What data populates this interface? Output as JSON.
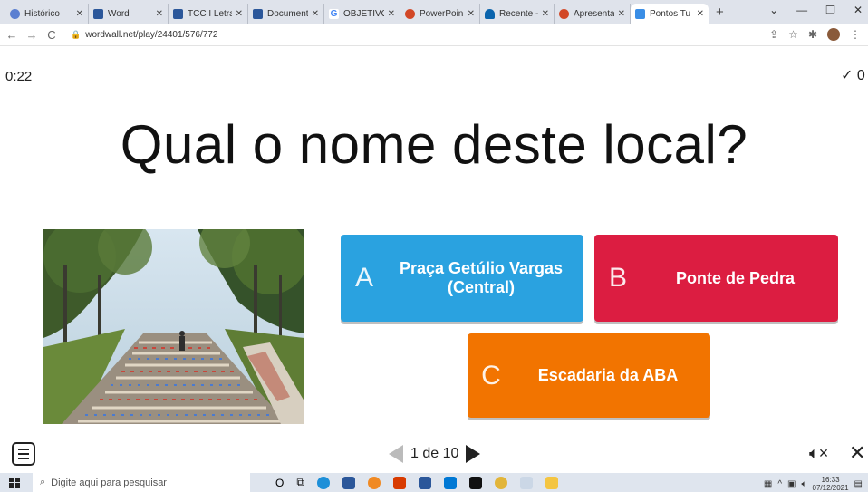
{
  "browser": {
    "tabs": [
      {
        "label": "Histórico",
        "color": "#5b7fd1"
      },
      {
        "label": "Word",
        "color": "#2b579a"
      },
      {
        "label": "TCC I Letra",
        "color": "#2b579a"
      },
      {
        "label": "Document",
        "color": "#2b579a"
      },
      {
        "label": "OBJETIVO",
        "color": "#4285f4"
      },
      {
        "label": "PowerPoin",
        "color": "#d24726"
      },
      {
        "label": "Recente -",
        "color": "#0a64ad"
      },
      {
        "label": "Apresenta",
        "color": "#d24726"
      },
      {
        "label": "Pontos Tu",
        "color": "#3a8ee6",
        "active": true
      }
    ],
    "url": "wordwall.net/play/24401/576/772"
  },
  "game": {
    "timer": "0:22",
    "score": "✓ 0",
    "question": "Qual o nome deste local?",
    "answers": [
      {
        "letter": "A",
        "text": "Praça Getúlio Vargas (Central)",
        "color": "#2aa2e0"
      },
      {
        "letter": "B",
        "text": "Ponte de Pedra",
        "color": "#dc1d41"
      },
      {
        "letter": "C",
        "text": "Escadaria da ABA",
        "color": "#f27400"
      }
    ],
    "pager": "1 de 10"
  },
  "taskbar": {
    "search_placeholder": "Digite aqui para pesquisar",
    "time": "16:33",
    "date": "07/12/2021"
  }
}
